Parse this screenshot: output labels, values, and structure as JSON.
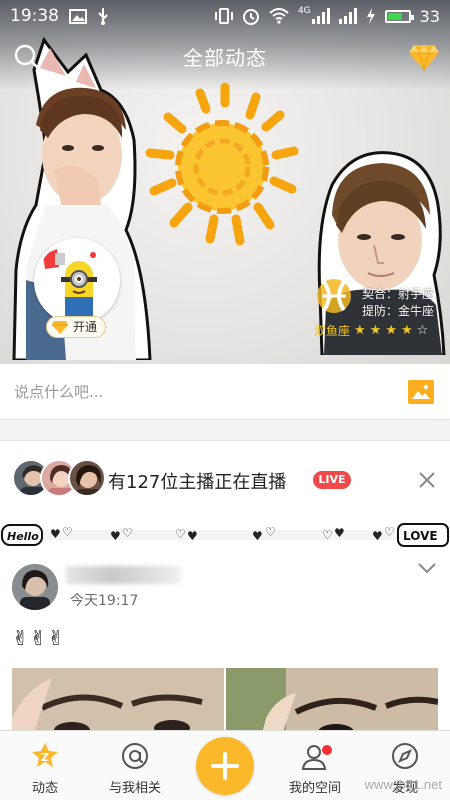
{
  "status_bar": {
    "time": "19:38",
    "network_label": "4G",
    "battery_level": "33",
    "battery_fill_percent": 70,
    "icons": [
      "image-icon",
      "usb-icon",
      "vibrate-icon",
      "alarm-icon",
      "wifi-icon",
      "signal-icon",
      "charging-icon",
      "battery-icon"
    ]
  },
  "header": {
    "title": "全部动态",
    "left_icon": "search-icon",
    "right_icon": "diamond-icon"
  },
  "profile": {
    "vip_label": "开通",
    "zodiac_sign": "双鱼座",
    "compat_lines": [
      "契合：射手座",
      "提防：金牛座"
    ],
    "rating": 4,
    "rating_max": 5
  },
  "compose": {
    "placeholder": "说点什么吧...",
    "image_icon": "image-icon"
  },
  "live": {
    "text": "有127位主播正在直播",
    "badge": "LIVE",
    "close_icon": "close-icon"
  },
  "doodle": {
    "left_word": "Hello",
    "right_word": "LOVE"
  },
  "post": {
    "time": "今天19:17",
    "text": "✌✌✌",
    "menu_icon": "chevron-down-icon"
  },
  "tabs": [
    {
      "label": "动态",
      "icon": "feed-icon",
      "active": true
    },
    {
      "label": "与我相关",
      "icon": "at-icon",
      "active": false
    },
    {
      "label": "",
      "icon": "plus-icon",
      "active": false
    },
    {
      "label": "我的空间",
      "icon": "profile-icon",
      "active": false
    },
    {
      "label": "发现",
      "icon": "compass-icon",
      "active": false
    }
  ],
  "watermark": "www.jb51.net",
  "colors": {
    "accent": "#fcb82b",
    "live_red": "#f04a4a",
    "star": "#f5c518"
  }
}
